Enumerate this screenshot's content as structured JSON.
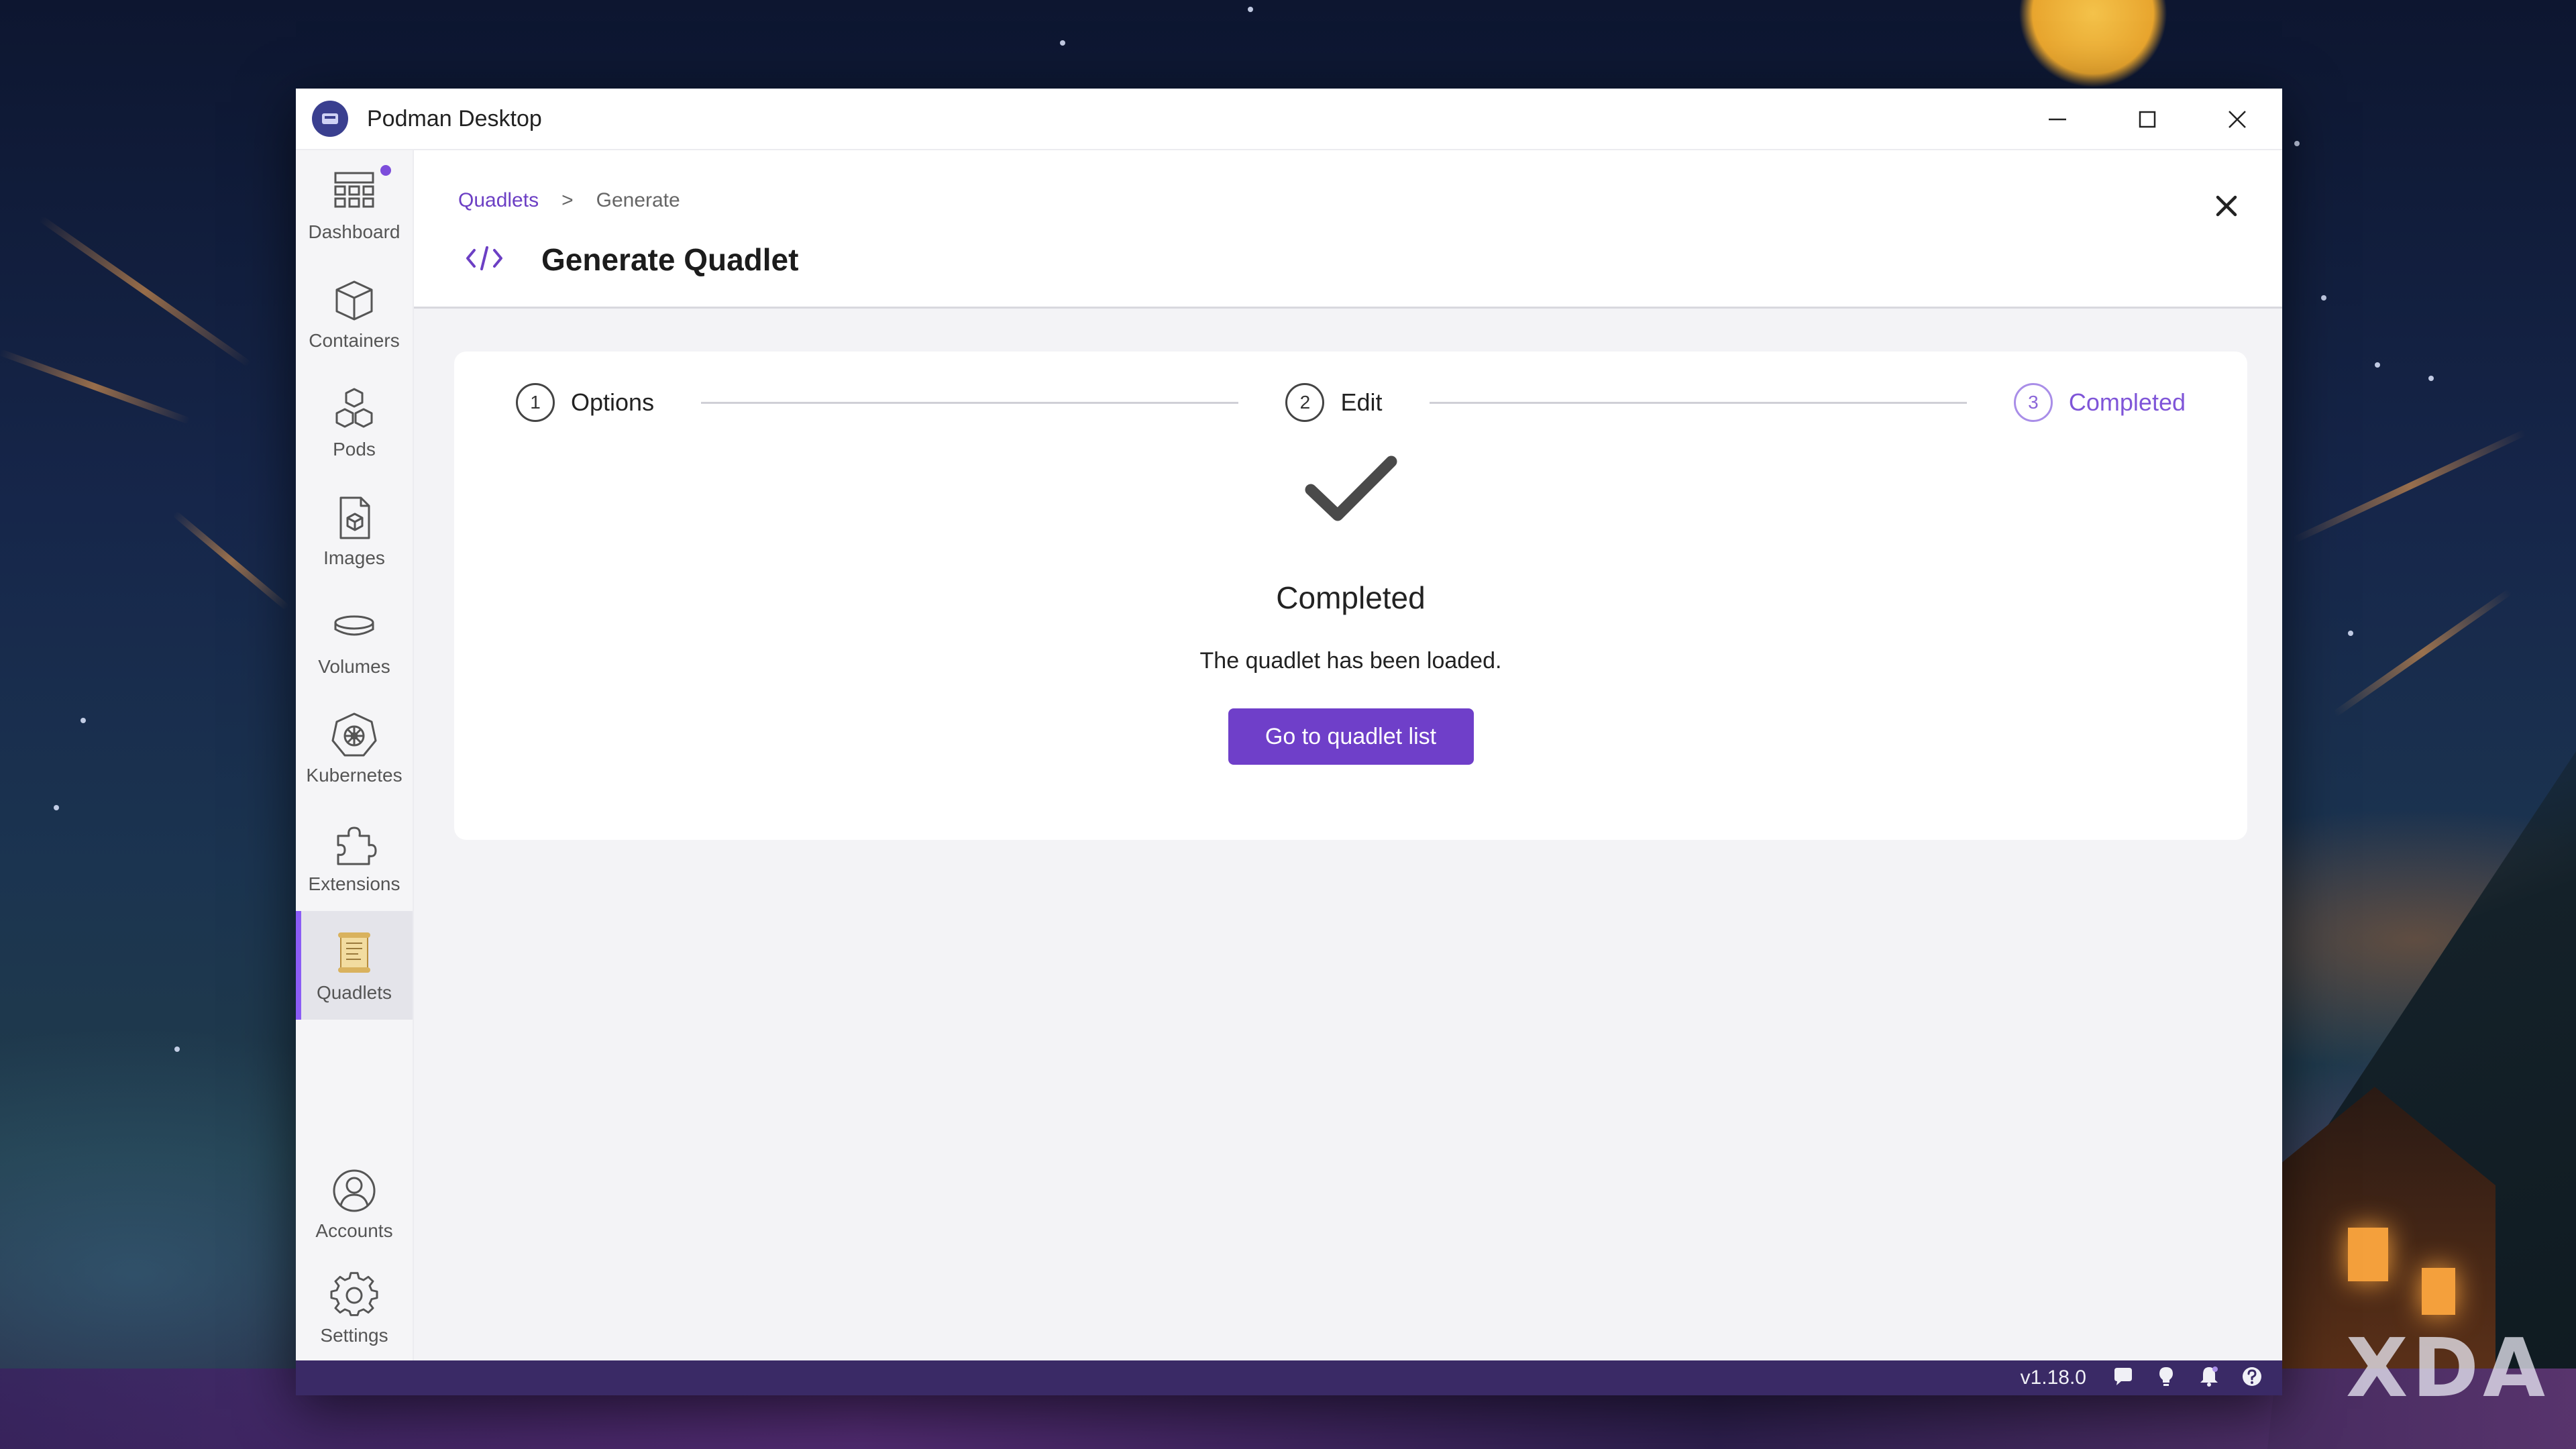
{
  "window": {
    "title": "Podman Desktop"
  },
  "sidebar": {
    "items": [
      {
        "label": "Dashboard",
        "icon": "dashboard-icon"
      },
      {
        "label": "Containers",
        "icon": "container-box-icon"
      },
      {
        "label": "Pods",
        "icon": "pods-icon"
      },
      {
        "label": "Images",
        "icon": "image-file-icon"
      },
      {
        "label": "Volumes",
        "icon": "volume-disk-icon"
      },
      {
        "label": "Kubernetes",
        "icon": "kubernetes-wheel-icon"
      },
      {
        "label": "Extensions",
        "icon": "puzzle-icon"
      },
      {
        "label": "Quadlets",
        "icon": "scroll-icon"
      }
    ],
    "active": "Quadlets",
    "bottom": [
      {
        "label": "Accounts",
        "icon": "account-icon"
      },
      {
        "label": "Settings",
        "icon": "gear-icon"
      }
    ]
  },
  "breadcrumb": {
    "parent": "Quadlets",
    "separator": ">",
    "current": "Generate"
  },
  "page": {
    "title": "Generate Quadlet",
    "icon": "code-icon"
  },
  "steps": [
    {
      "number": "1",
      "label": "Options"
    },
    {
      "number": "2",
      "label": "Edit"
    },
    {
      "number": "3",
      "label": "Completed"
    }
  ],
  "result": {
    "title": "Completed",
    "message": "The quadlet has been loaded.",
    "button": "Go to quadlet list"
  },
  "statusbar": {
    "version": "v1.18.0"
  },
  "watermark": "XDA",
  "colors": {
    "accent": "#6f3fc9",
    "statusbar": "#3a2a66",
    "step_active": "#7f55d8"
  }
}
